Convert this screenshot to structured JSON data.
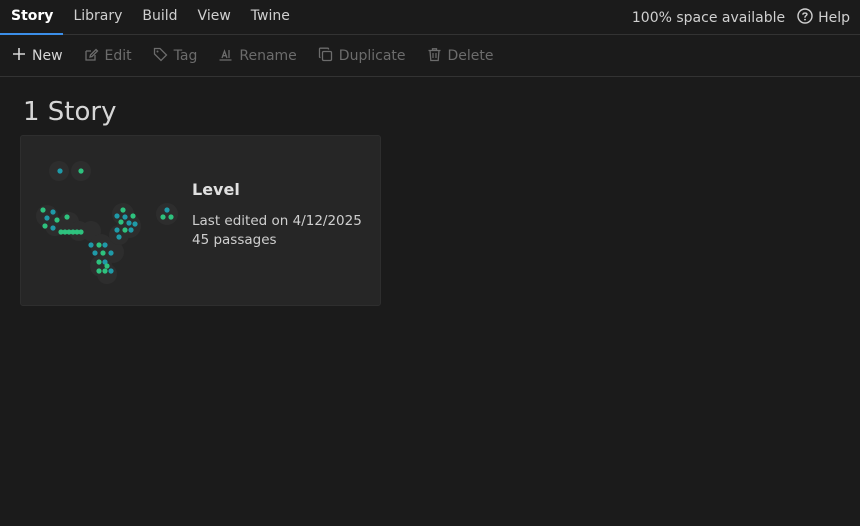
{
  "nav": {
    "tabs": [
      {
        "label": "Story",
        "active": true
      },
      {
        "label": "Library"
      },
      {
        "label": "Build"
      },
      {
        "label": "View"
      },
      {
        "label": "Twine"
      }
    ],
    "space_available": "100% space available",
    "help_label": "Help"
  },
  "toolbar": {
    "new_label": "New",
    "edit_label": "Edit",
    "tag_label": "Tag",
    "rename_label": "Rename",
    "duplicate_label": "Duplicate",
    "delete_label": "Delete"
  },
  "library": {
    "heading": "1 Story"
  },
  "story": {
    "title": "Level",
    "last_edited": "Last edited on 4/12/2025",
    "passages": "45 passages"
  },
  "colors": {
    "accent": "#3b8ee8",
    "dot_green": "#2ec27e",
    "dot_teal": "#1f9aa8"
  }
}
